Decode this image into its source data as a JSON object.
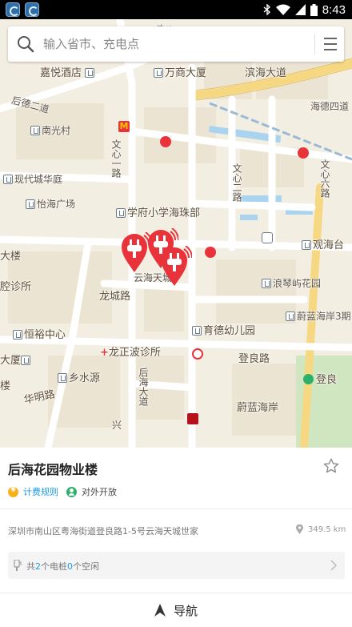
{
  "status_bar": {
    "time": "8:43",
    "icons": [
      "app-notification-icon",
      "app-notification-icon",
      "bluetooth-icon",
      "wifi-icon",
      "signal-icon",
      "battery-icon"
    ]
  },
  "search": {
    "placeholder": "输入省市、充电点",
    "value": ""
  },
  "map": {
    "labels": {
      "zhongxing": "中兴",
      "wanshang": "万商大厦",
      "binhai": "滨海大道",
      "jiayue": "嘉悦酒店",
      "houde2": "后德二道",
      "haide4": "海德四道",
      "nanguang": "南光村",
      "xiandai": "现代城华庭",
      "yihai": "怡海广场",
      "wenxin1": "文心一路",
      "wenxin2": "文心二路",
      "wenxin6": "文心六路",
      "xuefu": "学府小学海珠部",
      "guanhai": "观海台",
      "dalou": "大楼",
      "yunhai": "云海天城",
      "suo": "腔诊所",
      "longcheng": "龙城路",
      "langqin": "浪琴屿花园",
      "weilan3": "蔚蓝海岸3期",
      "hengyu": "恒裕中心",
      "yude": "育德幼儿园",
      "longzheng": "龙正波诊所",
      "dengliang": "登良路",
      "dasha": "大厦",
      "xiangshui": "乡水源",
      "houhai": "后海大道",
      "denglou": "登良",
      "lou": "楼",
      "huaming": "华明路",
      "weilan": "蔚蓝海岸",
      "xing": "兴"
    }
  },
  "station": {
    "name": "后海花园物业楼",
    "fee_label": "计费规则",
    "open_label": "对外开放",
    "address": "深圳市南山区粤海街道登良路1-5号云海天城世家",
    "distance": "349.5 km",
    "piles": {
      "prefix": "共",
      "total": "2",
      "mid": "个电桩",
      "idle": "0",
      "suffix": "个空闲"
    },
    "navigate_label": "导航"
  },
  "colors": {
    "accent": "#1a9be6",
    "marker": "#e8333a",
    "fee_icon": "#f5b21a",
    "open_icon": "#2db06b"
  }
}
